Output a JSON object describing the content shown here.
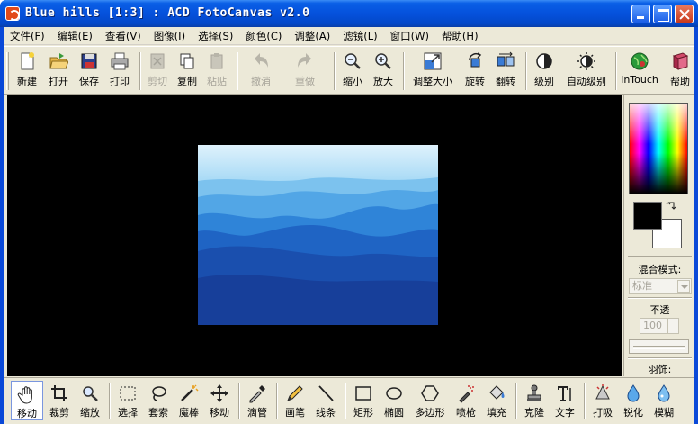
{
  "window": {
    "title": "Blue hills [1:3] : ACD FotoCanvas v2.0"
  },
  "menubar": {
    "items": [
      {
        "label": "文件(F)"
      },
      {
        "label": "编辑(E)"
      },
      {
        "label": "查看(V)"
      },
      {
        "label": "图像(I)"
      },
      {
        "label": "选择(S)"
      },
      {
        "label": "颜色(C)"
      },
      {
        "label": "调整(A)"
      },
      {
        "label": "滤镜(L)"
      },
      {
        "label": "窗口(W)"
      },
      {
        "label": "帮助(H)"
      }
    ]
  },
  "toolbar": {
    "buttons": [
      {
        "label": "新建",
        "icon": "new-file-icon",
        "enabled": true
      },
      {
        "label": "打开",
        "icon": "open-folder-icon",
        "enabled": true
      },
      {
        "label": "保存",
        "icon": "save-disk-icon",
        "enabled": true
      },
      {
        "label": "打印",
        "icon": "printer-icon",
        "enabled": true
      },
      {
        "label": "剪切",
        "icon": "cut-icon",
        "enabled": false
      },
      {
        "label": "复制",
        "icon": "copy-icon",
        "enabled": true
      },
      {
        "label": "粘贴",
        "icon": "paste-icon",
        "enabled": false
      },
      {
        "label": "撤消",
        "icon": "undo-icon",
        "enabled": false
      },
      {
        "label": "重做",
        "icon": "redo-icon",
        "enabled": false
      },
      {
        "label": "缩小",
        "icon": "zoom-out-icon",
        "enabled": true
      },
      {
        "label": "放大",
        "icon": "zoom-in-icon",
        "enabled": true
      },
      {
        "label": "调整大小",
        "icon": "resize-icon",
        "enabled": true
      },
      {
        "label": "旋转",
        "icon": "rotate-icon",
        "enabled": true
      },
      {
        "label": "翻转",
        "icon": "flip-icon",
        "enabled": true
      },
      {
        "label": "级别",
        "icon": "levels-icon",
        "enabled": true
      },
      {
        "label": "自动级别",
        "icon": "auto-levels-icon",
        "enabled": true
      },
      {
        "label": "InTouch",
        "icon": "intouch-globe-icon",
        "enabled": true
      },
      {
        "label": "帮助",
        "icon": "help-book-icon",
        "enabled": true
      }
    ]
  },
  "image": {
    "name": "Blue hills"
  },
  "color_panel": {
    "foreground": "#000000",
    "background": "#ffffff",
    "blend_mode_label": "混合模式:",
    "blend_mode_value": "标准",
    "opacity_label": "不透",
    "opacity_value": "100",
    "feather_label": "羽饰:"
  },
  "tools": {
    "items": [
      {
        "label": "移动",
        "icon": "hand-icon",
        "active": true
      },
      {
        "label": "裁剪",
        "icon": "crop-icon",
        "active": false
      },
      {
        "label": "缩放",
        "icon": "zoom-tool-icon",
        "active": false
      },
      {
        "label": "选择",
        "icon": "rect-select-icon",
        "active": false
      },
      {
        "label": "套索",
        "icon": "lasso-icon",
        "active": false
      },
      {
        "label": "魔棒",
        "icon": "magic-wand-icon",
        "active": false
      },
      {
        "label": "移动",
        "icon": "move-arrows-icon",
        "active": false
      },
      {
        "label": "滴管",
        "icon": "eyedropper-icon",
        "active": false
      },
      {
        "label": "画笔",
        "icon": "pencil-icon",
        "active": false
      },
      {
        "label": "线条",
        "icon": "line-icon",
        "active": false
      },
      {
        "label": "矩形",
        "icon": "rectangle-icon",
        "active": false
      },
      {
        "label": "椭圆",
        "icon": "ellipse-icon",
        "active": false
      },
      {
        "label": "多边形",
        "icon": "polygon-icon",
        "active": false
      },
      {
        "label": "喷枪",
        "icon": "airbrush-icon",
        "active": false
      },
      {
        "label": "填充",
        "icon": "fill-bucket-icon",
        "active": false
      },
      {
        "label": "克隆",
        "icon": "clone-stamp-icon",
        "active": false
      },
      {
        "label": "文字",
        "icon": "text-icon",
        "active": false
      },
      {
        "label": "打吸",
        "icon": "burn-icon",
        "active": false
      },
      {
        "label": "锐化",
        "icon": "sharpen-icon",
        "active": false
      },
      {
        "label": "模糊",
        "icon": "blur-icon",
        "active": false
      }
    ]
  },
  "colors": {
    "titlebar": "#0551dc",
    "chrome": "#ece9d8",
    "canvas_bg": "#000000"
  }
}
